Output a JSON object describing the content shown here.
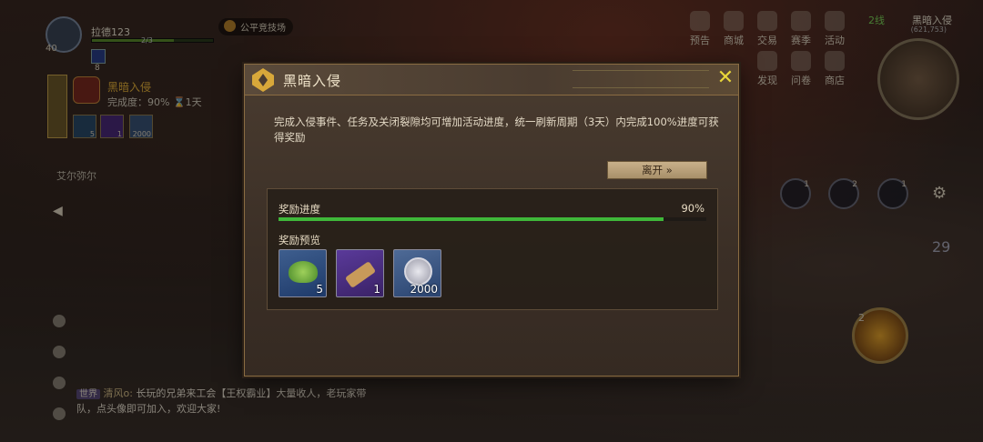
{
  "player": {
    "name": "拉德123",
    "level": "40",
    "hp_text": "2/3",
    "buff_count": "8",
    "arena": "公平竞技场"
  },
  "quest_tracker": {
    "title": "黑暗入侵",
    "progress": "完成度：90%  ⌛1天",
    "items": [
      {
        "count": "5"
      },
      {
        "count": "1"
      },
      {
        "count": "2000"
      }
    ],
    "location": "艾尔弥尔"
  },
  "top_menu": [
    {
      "label": "预告",
      "icon": "notice-icon"
    },
    {
      "label": "商城",
      "icon": "shop-icon"
    },
    {
      "label": "交易",
      "icon": "trade-icon"
    },
    {
      "label": "赛季",
      "icon": "season-icon"
    },
    {
      "label": "活动",
      "icon": "event-icon"
    }
  ],
  "second_menu": [
    {
      "label": "发现",
      "icon": "discover-icon"
    },
    {
      "label": "问卷",
      "icon": "survey-icon"
    },
    {
      "label": "商店",
      "icon": "store-icon"
    }
  ],
  "map": {
    "line": "2线",
    "location": "黑暗入侵",
    "coords": "(621,753)"
  },
  "skills": {
    "slots": [
      "1",
      "2",
      "1"
    ],
    "big_skill_level": "2",
    "cooldown": "29"
  },
  "chat": {
    "channel": "世界",
    "sender": "清风o:",
    "message": "长玩的兄弟来工会【王权霸业】大量收人，老玩家带队，点头像即可加入，欢迎大家!"
  },
  "dialog": {
    "title": "黑暗入侵",
    "description": "完成入侵事件、任务及关闭裂隙均可增加活动进度，统一刷新周期（3天）内完成100%进度可获得奖励",
    "leave_label": "离开 »",
    "progress_label": "奖励进度",
    "progress_percent": "90%",
    "progress_value": 0.9,
    "rewards_label": "奖励预览",
    "rewards": [
      {
        "icon": "herb-icon",
        "count": "5"
      },
      {
        "icon": "scroll-icon",
        "count": "1"
      },
      {
        "icon": "silver-coin-icon",
        "count": "2000"
      }
    ]
  },
  "colors": {
    "accent": "#e8b33a",
    "progress": "#3fb83a",
    "close": "#e8d63a"
  }
}
